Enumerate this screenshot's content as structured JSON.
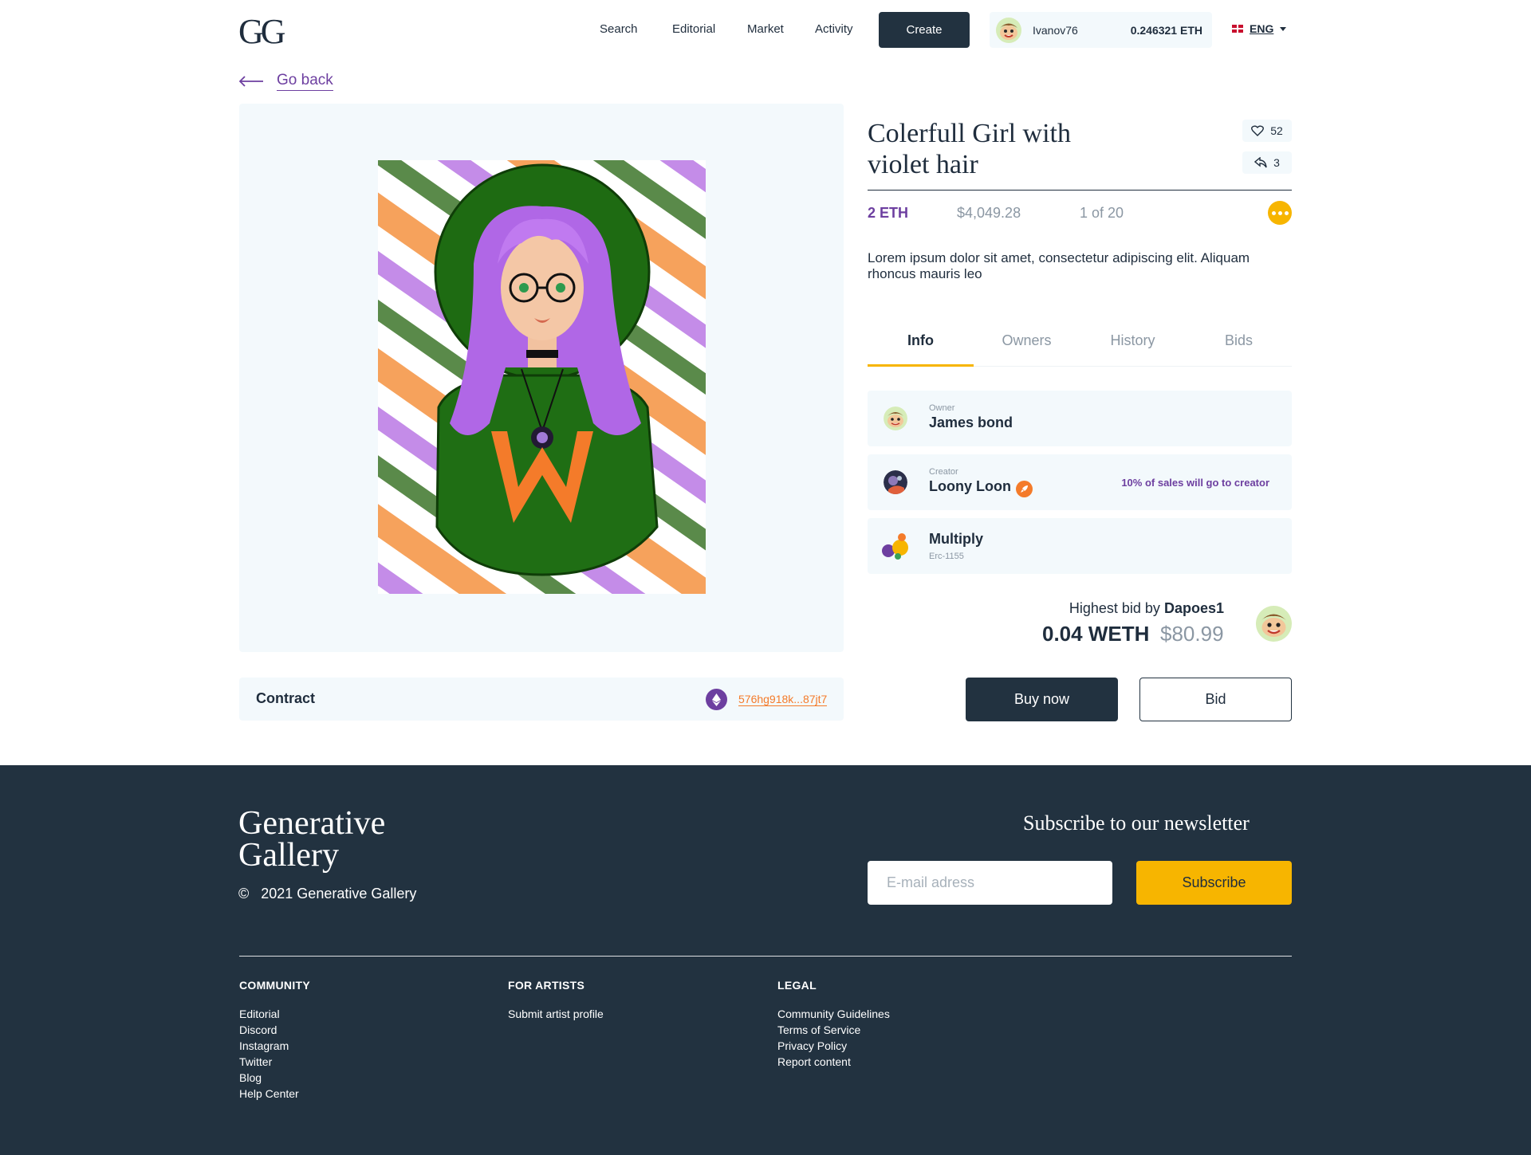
{
  "header": {
    "logo": "GG",
    "nav": [
      "Search",
      "Editorial",
      "Market",
      "Activity"
    ],
    "create_label": "Create",
    "wallet": {
      "username": "Ivanov76",
      "balance": "0.246321 ETH"
    },
    "language": "ENG"
  },
  "goback_label": "Go back",
  "artwork": {
    "title": "Colerfull Girl with violet hair",
    "likes": "52",
    "shares": "3",
    "price_eth": "2 ETH",
    "price_usd": "$4,049.28",
    "edition": "1 of 20",
    "description": "Lorem ipsum dolor sit amet, consectetur adipiscing elit. Aliquam rhoncus mauris leo"
  },
  "tabs": [
    "Info",
    "Owners",
    "History",
    "Bids"
  ],
  "info": {
    "owner": {
      "label": "Owner",
      "name": "James bond"
    },
    "creator": {
      "label": "Creator",
      "name": "Loony Loon",
      "note": "10% of sales will go to creator"
    },
    "standard": {
      "name": "Multiply",
      "type": "Erc-1155"
    }
  },
  "bid": {
    "prefix": "Highest bid by",
    "bidder": "Dapoes1",
    "amount": "0.04 WETH",
    "usd": "$80.99"
  },
  "actions": {
    "buy": "Buy now",
    "bid": "Bid"
  },
  "contract": {
    "label": "Contract",
    "address": "576hg918k...87jt7"
  },
  "footer": {
    "brand_line1": "Generative",
    "brand_line2": "Gallery",
    "copyright": "©   2021 Generative Gallery",
    "newsletter_title": "Subscribe to our newsletter",
    "email_placeholder": "E-mail adress",
    "subscribe_label": "Subscribe",
    "columns": [
      {
        "title": "COMMUNITY",
        "links": [
          "Editorial",
          "Discord",
          "Instagram",
          "Twitter",
          "Blog",
          "Help Center"
        ]
      },
      {
        "title": "FOR ARTISTS",
        "links": [
          "Submit artist profile"
        ]
      },
      {
        "title": "LEGAL",
        "links": [
          "Community Guidelines",
          "Terms of Service",
          "Privacy Policy",
          "Report content"
        ]
      }
    ]
  },
  "colors": {
    "dark": "#223240",
    "accent_purple": "#6d3fa0",
    "accent_yellow": "#f7b500",
    "accent_orange": "#f47b2a",
    "panel": "#f3f9fc"
  }
}
